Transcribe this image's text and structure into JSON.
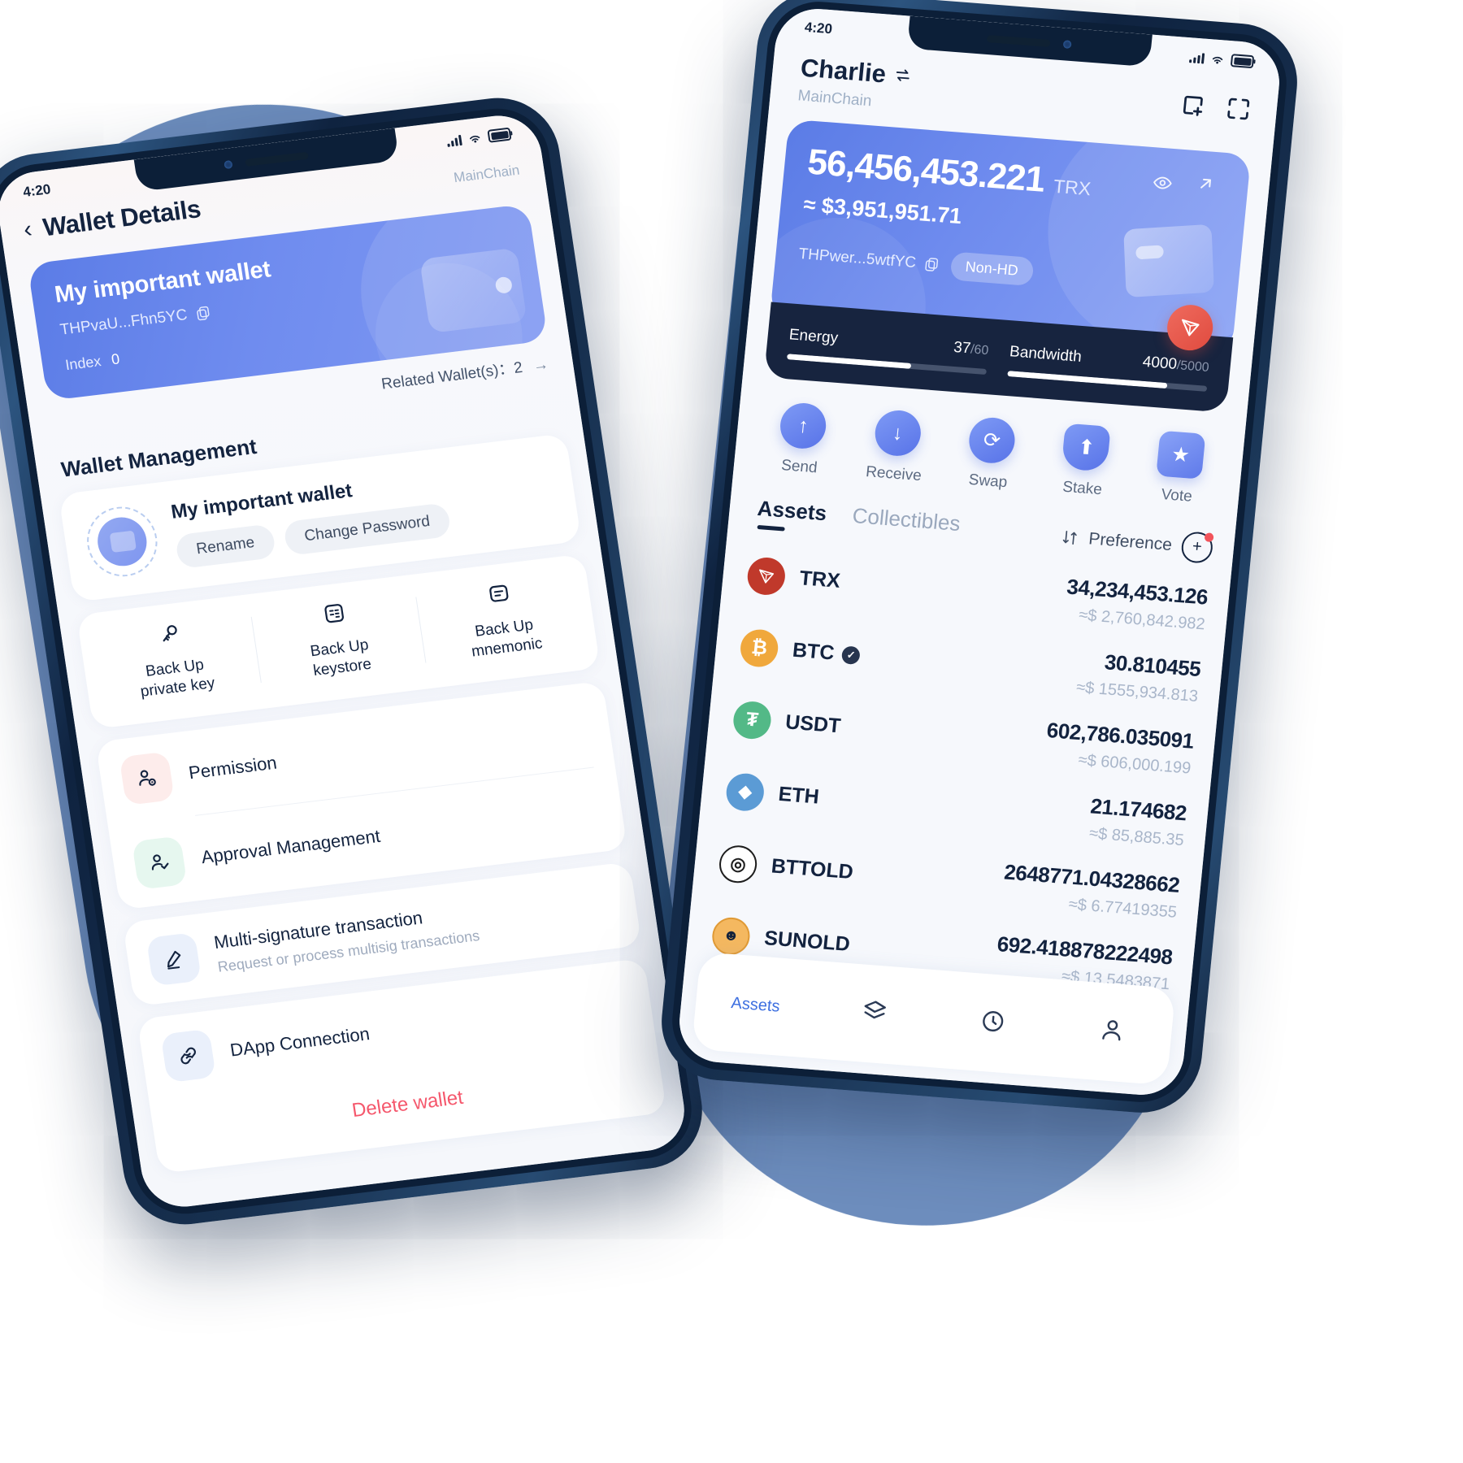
{
  "left_phone": {
    "status": {
      "time": "4:20"
    },
    "nav": {
      "back_icon": "chevron-left",
      "title": "Wallet Details",
      "chain": "MainChain"
    },
    "wallet_card": {
      "name": "My important wallet",
      "address": "THPvaU...Fhn5YC",
      "copy_icon": "copy-icon",
      "index_label": "Index",
      "index_value": "0"
    },
    "related": {
      "label": "Related Wallet(s)：2",
      "arrow": "→"
    },
    "section_title": "Wallet Management",
    "wallet_row": {
      "name": "My important wallet",
      "rename_label": "Rename",
      "change_password_label": "Change Password"
    },
    "backups": [
      {
        "icon": "key-icon",
        "line1": "Back Up",
        "line2": "private key"
      },
      {
        "icon": "keystore-icon",
        "line1": "Back Up",
        "line2": "keystore"
      },
      {
        "icon": "mnemonic-icon",
        "line1": "Back Up",
        "line2": "mnemonic"
      }
    ],
    "menu": [
      {
        "icon": "permission-icon",
        "title": "Permission",
        "sub": ""
      },
      {
        "icon": "approval-icon",
        "title": "Approval Management",
        "sub": ""
      },
      {
        "icon": "pencil-icon",
        "title": "Multi-signature transaction",
        "sub": "Request or process multisig transactions"
      },
      {
        "icon": "link-icon",
        "title": "DApp Connection",
        "sub": ""
      }
    ],
    "delete_label": "Delete wallet"
  },
  "right_phone": {
    "status": {
      "time": "4:20"
    },
    "header": {
      "account_name": "Charlie",
      "switch_icon": "switch-arrows-icon",
      "chain": "MainChain",
      "add_icon": "add-wallet-icon",
      "scan_icon": "scan-icon"
    },
    "balance_card": {
      "amount": "56,456,453.221",
      "unit": "TRX",
      "fiat": "≈ $3,951,951.71",
      "address": "THPwer...5wtfYC",
      "copy_icon": "copy-icon",
      "hd_badge": "Non-HD",
      "eye_icon": "eye-icon",
      "expand_icon": "arrow-up-right-icon",
      "token_badge_icon": "tron-logo-icon"
    },
    "resources": [
      {
        "label": "Energy",
        "used": "37",
        "total": "60",
        "percent": 62
      },
      {
        "label": "Bandwidth",
        "used": "4000",
        "total": "5000",
        "percent": 80
      }
    ],
    "actions": [
      {
        "icon": "arrow-up-icon",
        "label": "Send"
      },
      {
        "icon": "arrow-down-icon",
        "label": "Receive"
      },
      {
        "icon": "swap-icon",
        "label": "Swap"
      },
      {
        "icon": "shield-icon",
        "label": "Stake"
      },
      {
        "icon": "ticket-icon",
        "label": "Vote"
      }
    ],
    "tabs": [
      {
        "label": "Assets",
        "active": true
      },
      {
        "label": "Collectibles",
        "active": false
      }
    ],
    "preference": {
      "sort_icon": "sort-icon",
      "label": "Preference",
      "add_icon": "add-token-icon"
    },
    "assets": [
      {
        "symbol": "TRX",
        "verified": false,
        "amount": "34,234,453.126",
        "fiat": "≈$ 2,760,842.982",
        "color": "#c0392b",
        "glyph": "▷"
      },
      {
        "symbol": "BTC",
        "verified": true,
        "amount": "30.810455",
        "fiat": "≈$ 1555,934.813",
        "color": "#f0a83c",
        "glyph": "₿"
      },
      {
        "symbol": "USDT",
        "verified": false,
        "amount": "602,786.035091",
        "fiat": "≈$ 606,000.199",
        "color": "#53b987",
        "glyph": "₮"
      },
      {
        "symbol": "ETH",
        "verified": false,
        "amount": "21.174682",
        "fiat": "≈$ 85,885.35",
        "color": "#5b9bd5",
        "glyph": "◆"
      },
      {
        "symbol": "BTTOLD",
        "verified": false,
        "amount": "2648771.04328662",
        "fiat": "≈$ 6.77419355",
        "color": "#ffffff",
        "glyph": "◎"
      },
      {
        "symbol": "SUNOLD",
        "verified": false,
        "amount": "692.418878222498",
        "fiat": "≈$ 13.5483871",
        "color": "#f4b860",
        "glyph": "☻"
      }
    ],
    "bottom_nav": [
      {
        "icon": "assets-icon",
        "label": "Assets",
        "active": true
      },
      {
        "icon": "layers-icon",
        "label": "",
        "active": false
      },
      {
        "icon": "explore-icon",
        "label": "",
        "active": false
      },
      {
        "icon": "profile-icon",
        "label": "",
        "active": false
      }
    ]
  },
  "colors": {
    "accent": "#5b7ce6",
    "danger": "#f5576c",
    "dark": "#17243f"
  }
}
